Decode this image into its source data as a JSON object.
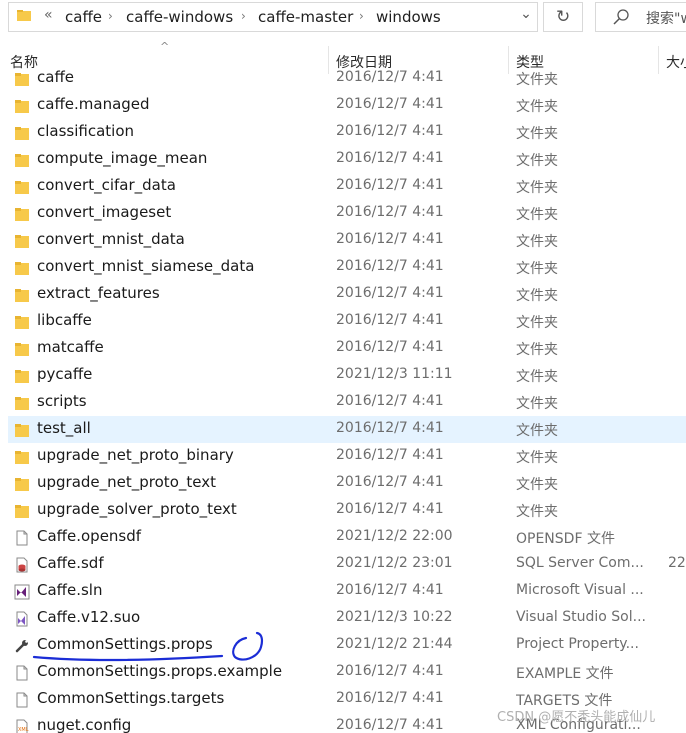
{
  "address_bar": {
    "overflow_glyph": "«",
    "crumbs": [
      "caffe",
      "caffe-windows",
      "caffe-master",
      "windows"
    ],
    "separator": "›",
    "dropdown_glyph": "⌄",
    "refresh_glyph": "↻",
    "search_placeholder": "搜索\"w"
  },
  "columns": {
    "name": "名称",
    "date": "修改日期",
    "type": "类型",
    "size": "大小"
  },
  "files": [
    {
      "name": "caffe",
      "date": "2016/12/7 4:41",
      "type": "文件夹",
      "size": "",
      "icon": "folder-icon"
    },
    {
      "name": "caffe.managed",
      "date": "2016/12/7 4:41",
      "type": "文件夹",
      "size": "",
      "icon": "folder-icon"
    },
    {
      "name": "classification",
      "date": "2016/12/7 4:41",
      "type": "文件夹",
      "size": "",
      "icon": "folder-icon"
    },
    {
      "name": "compute_image_mean",
      "date": "2016/12/7 4:41",
      "type": "文件夹",
      "size": "",
      "icon": "folder-icon"
    },
    {
      "name": "convert_cifar_data",
      "date": "2016/12/7 4:41",
      "type": "文件夹",
      "size": "",
      "icon": "folder-icon"
    },
    {
      "name": "convert_imageset",
      "date": "2016/12/7 4:41",
      "type": "文件夹",
      "size": "",
      "icon": "folder-icon"
    },
    {
      "name": "convert_mnist_data",
      "date": "2016/12/7 4:41",
      "type": "文件夹",
      "size": "",
      "icon": "folder-icon"
    },
    {
      "name": "convert_mnist_siamese_data",
      "date": "2016/12/7 4:41",
      "type": "文件夹",
      "size": "",
      "icon": "folder-icon"
    },
    {
      "name": "extract_features",
      "date": "2016/12/7 4:41",
      "type": "文件夹",
      "size": "",
      "icon": "folder-icon"
    },
    {
      "name": "libcaffe",
      "date": "2016/12/7 4:41",
      "type": "文件夹",
      "size": "",
      "icon": "folder-icon"
    },
    {
      "name": "matcaffe",
      "date": "2016/12/7 4:41",
      "type": "文件夹",
      "size": "",
      "icon": "folder-icon"
    },
    {
      "name": "pycaffe",
      "date": "2021/12/3 11:11",
      "type": "文件夹",
      "size": "",
      "icon": "folder-icon"
    },
    {
      "name": "scripts",
      "date": "2016/12/7 4:41",
      "type": "文件夹",
      "size": "",
      "icon": "folder-icon"
    },
    {
      "name": "test_all",
      "date": "2016/12/7 4:41",
      "type": "文件夹",
      "size": "",
      "icon": "folder-icon",
      "selected": true
    },
    {
      "name": "upgrade_net_proto_binary",
      "date": "2016/12/7 4:41",
      "type": "文件夹",
      "size": "",
      "icon": "folder-icon"
    },
    {
      "name": "upgrade_net_proto_text",
      "date": "2016/12/7 4:41",
      "type": "文件夹",
      "size": "",
      "icon": "folder-icon"
    },
    {
      "name": "upgrade_solver_proto_text",
      "date": "2016/12/7 4:41",
      "type": "文件夹",
      "size": "",
      "icon": "folder-icon"
    },
    {
      "name": "Caffe.opensdf",
      "date": "2021/12/2 22:00",
      "type": "OPENSDF 文件",
      "size": "",
      "icon": "blank-file-icon"
    },
    {
      "name": "Caffe.sdf",
      "date": "2021/12/2 23:01",
      "type": "SQL Server Com...",
      "size": "22",
      "icon": "sql-database-icon"
    },
    {
      "name": "Caffe.sln",
      "date": "2016/12/7 4:41",
      "type": "Microsoft Visual ...",
      "size": "",
      "icon": "visual-studio-solution-icon"
    },
    {
      "name": "Caffe.v12.suo",
      "date": "2021/12/3 10:22",
      "type": "Visual Studio Sol...",
      "size": "",
      "icon": "visual-studio-suo-icon"
    },
    {
      "name": "CommonSettings.props",
      "date": "2021/12/2 21:44",
      "type": "Project Property...",
      "size": "",
      "icon": "wrench-icon"
    },
    {
      "name": "CommonSettings.props.example",
      "date": "2016/12/7 4:41",
      "type": "EXAMPLE 文件",
      "size": "",
      "icon": "blank-file-icon"
    },
    {
      "name": "CommonSettings.targets",
      "date": "2016/12/7 4:41",
      "type": "TARGETS 文件",
      "size": "",
      "icon": "blank-file-icon"
    },
    {
      "name": "nuget.config",
      "date": "2016/12/7 4:41",
      "type": "XML Configurati...",
      "size": "",
      "icon": "xml-file-icon"
    }
  ],
  "colors": {
    "folder": "#f7c94a",
    "folder_tab": "#e8b431",
    "selection": "#e5f3ff",
    "annotation": "#1b2dd6"
  },
  "watermark": "CSDN @愿不秃头能成仙儿"
}
